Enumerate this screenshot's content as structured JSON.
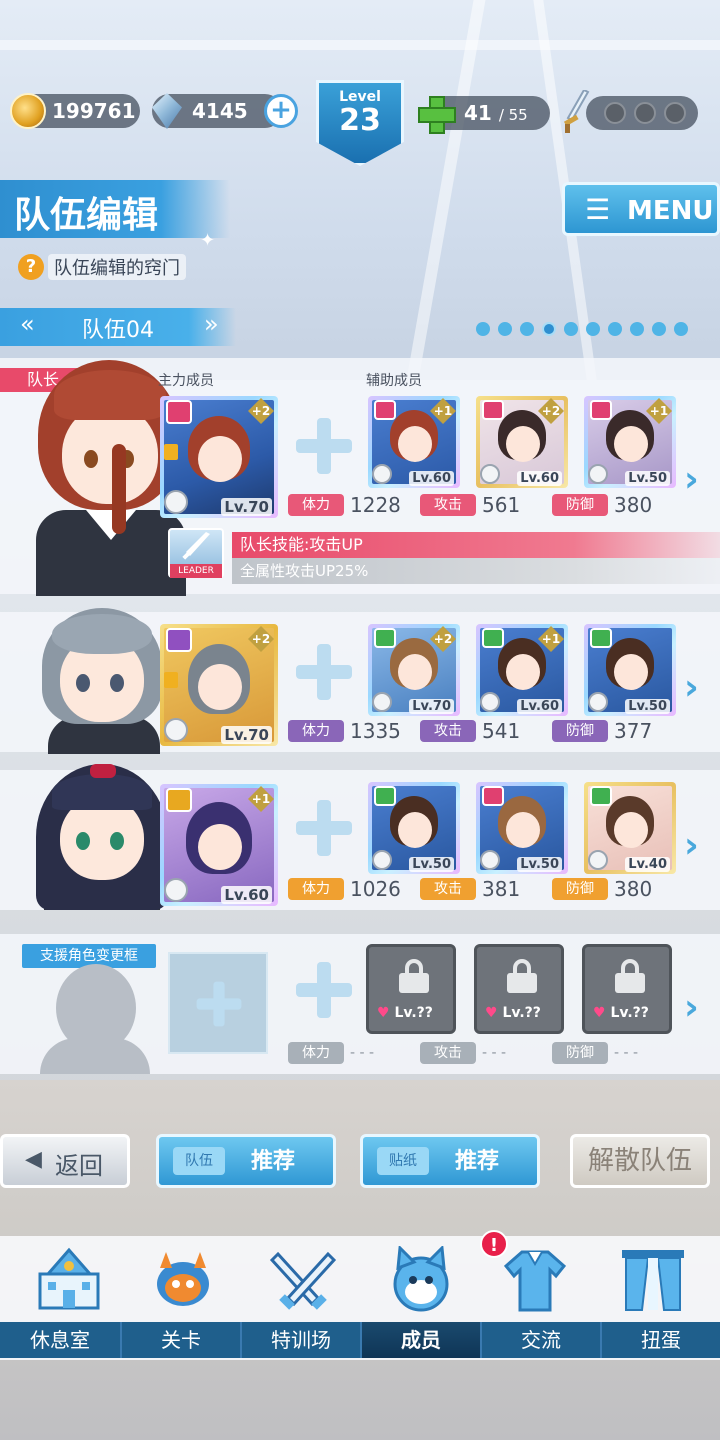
{
  "status_bar": {
    "coins": "199761",
    "crystals": "4145",
    "level_label": "Level",
    "level": "23",
    "stamina": "41",
    "stamina_max": "/ 55"
  },
  "header": {
    "title": "队伍编辑",
    "menu_label": "MENU",
    "hint": "队伍编辑的窍门",
    "team_name": "队伍04",
    "page_count": 10,
    "page_active": 3
  },
  "labels": {
    "leader_tag": "队长",
    "main_member": "主力成员",
    "support_member": "辅助成员",
    "stat_hp": "体力",
    "stat_atk": "攻击",
    "stat_def": "防御",
    "support_change": "支援角色变更框",
    "leader_icon_label": "LEADER"
  },
  "rows": [
    {
      "main": {
        "level": "Lv.70",
        "plus": "+2",
        "attr": "red"
      },
      "supports": [
        {
          "level": "Lv.60",
          "plus": "+1",
          "attr": "red"
        },
        {
          "level": "Lv.60",
          "plus": "+2",
          "attr": "red"
        },
        {
          "level": "Lv.50",
          "plus": "+1",
          "attr": "red"
        }
      ],
      "hp": "1228",
      "atk": "561",
      "def": "380",
      "leader_skill": "队长技能:攻击UP",
      "leader_skill_desc": "全属性攻击UP25%"
    },
    {
      "main": {
        "level": "Lv.70",
        "plus": "+2",
        "attr": "purple"
      },
      "supports": [
        {
          "level": "Lv.70",
          "plus": "+2",
          "attr": "green"
        },
        {
          "level": "Lv.60",
          "plus": "+1",
          "attr": "green"
        },
        {
          "level": "Lv.50",
          "plus": "",
          "attr": "green"
        }
      ],
      "hp": "1335",
      "atk": "541",
      "def": "377"
    },
    {
      "main": {
        "level": "Lv.60",
        "plus": "+1",
        "attr": "yellow"
      },
      "supports": [
        {
          "level": "Lv.50",
          "plus": "",
          "attr": "green"
        },
        {
          "level": "Lv.50",
          "plus": "",
          "attr": "red"
        },
        {
          "level": "Lv.40",
          "plus": "",
          "attr": "green"
        }
      ],
      "hp": "1026",
      "atk": "381",
      "def": "380"
    },
    {
      "locked_level": "Lv.??",
      "hp": "- - -",
      "atk": "- - -",
      "def": "- - -"
    }
  ],
  "buttons": {
    "back": "返回",
    "team_small": "队伍",
    "team_recommend": "推荐",
    "sticker_small": "贴纸",
    "sticker_recommend": "推荐",
    "disband": "解散队伍"
  },
  "nav": {
    "items": [
      "休息室",
      "关卡",
      "特训场",
      "成员",
      "交流",
      "扭蛋"
    ],
    "active": 3,
    "notification": "!"
  },
  "colors": {
    "accent_blue": "#3aa0e0",
    "leader_pink": "#e84a6a",
    "hp_tag_red": "#e85878",
    "hp_tag_purple": "#8a66b8",
    "hp_tag_orange": "#f0a030"
  }
}
